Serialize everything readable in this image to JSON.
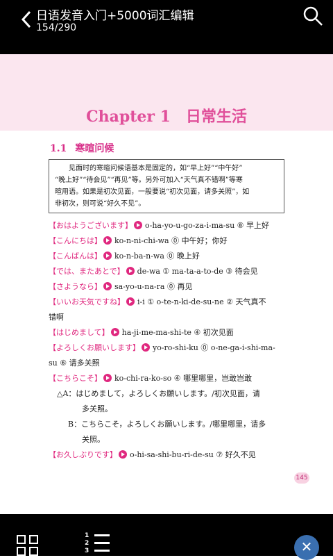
{
  "header": {
    "title": "日语发音入门+5000词汇编辑",
    "page_info": "154/290"
  },
  "chapter": {
    "title": "Chapter 1　日常生活"
  },
  "section": {
    "number": "1.1",
    "title": "寒暄问候"
  },
  "intro": {
    "lines": [
      "见面时的寒暄问候语基本是固定的，如“早上好”“中午好”",
      "“晚上好”“待会见”“再见”等。另外可加入“天气真不错啊”等寒",
      "暄用语。如果是初次见面，一般要说“初次见面，请多关照”，如",
      "非初次，则可说“好久不见”。"
    ]
  },
  "phrases": [
    {
      "jp": "【おはようございます】",
      "roma": "o-ha-yo-u-go-za-i-ma-su ⑧",
      "meaning": "早上好"
    },
    {
      "jp": "【こんにちは】",
      "roma": "ko-n-ni-chi-wa ⓪",
      "meaning": "中午好；你好"
    },
    {
      "jp": "【こんばんは】",
      "roma": "ko-n-ba-n-wa ⓪",
      "meaning": "晚上好"
    },
    {
      "jp": "【では、またあとで】",
      "roma": "de-wa ① ma-ta-a-to-de ③",
      "meaning": "待会见"
    },
    {
      "jp": "【さようなら】",
      "roma": "sa-yo-u-na-ra ⓪",
      "meaning": "再见"
    },
    {
      "jp": "【いいお天気ですね】",
      "roma": "i-i ① o-te-n-ki-de-su-ne ②",
      "meaning": "天气真不",
      "cont": "错啊"
    },
    {
      "jp": "【はじめまして】",
      "roma": "ha-ji-me-ma-shi-te ④",
      "meaning": "初次见面"
    },
    {
      "jp": "【よろしくお願いします】",
      "roma": "yo-ro-shi-ku ⓪ o-ne-ga-i-shi-ma-",
      "meaning": "",
      "cont": "su ⑥ 请多关照"
    },
    {
      "jp": "【こちらこそ】",
      "roma": "ko-chi-ra-ko-so ④",
      "meaning": "哪里哪里，岂敢岂敢"
    }
  ],
  "dialog": [
    "△A：はじめまして，よろしくお願いします。/初次见面，请",
    "多关照。",
    "B：こちらこそ，よろしくお願いします。/哪里哪里，请多",
    "关照。"
  ],
  "last_phrase": {
    "jp": "【お久しぶりです】",
    "roma": "o-hi-sa-shi-bu-ri-de-su ⑦",
    "meaning": "好久不见"
  },
  "page_number": "145",
  "toc_numbers": [
    "1",
    "2",
    "3"
  ],
  "close_label": "✕",
  "colors": {
    "accent": "#e0287f",
    "banner": "#fbe6ef",
    "bar": "#000000"
  }
}
